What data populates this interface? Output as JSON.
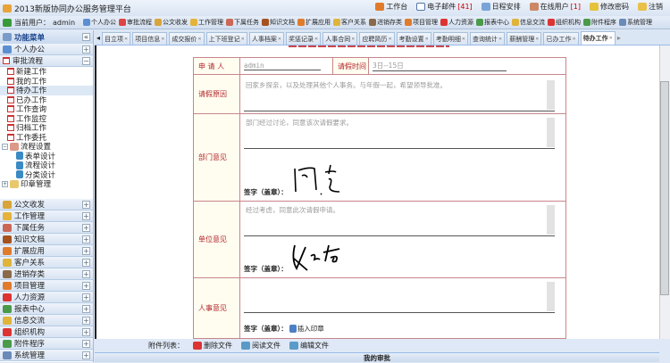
{
  "app": {
    "title": "2013新版协同办公服务管理平台"
  },
  "toplinks": [
    {
      "label": "工作台",
      "icon": "home-icon"
    },
    {
      "label": "电子邮件",
      "count": "[41]",
      "icon": "mail-icon"
    },
    {
      "label": "日程安排",
      "icon": "calendar-icon"
    },
    {
      "label": "在线用户",
      "count": "[1]",
      "icon": "user-icon"
    },
    {
      "label": "修改密码",
      "icon": "key-icon"
    },
    {
      "label": "注销",
      "icon": "logout-icon"
    }
  ],
  "user": {
    "label": "当前用户：",
    "name": "admin"
  },
  "modules": [
    "个人办公",
    "审批流程",
    "公文收发",
    "工作管理",
    "下属任务",
    "知识文档",
    "扩展应用",
    "客户关系",
    "进销存类",
    "项目管理",
    "人力资源",
    "报表中心",
    "信息交流",
    "组织机构",
    "附件程序",
    "系统管理"
  ],
  "sidebar": {
    "title": "功能菜单",
    "open_sections": [
      "个人办公",
      "审批流程"
    ],
    "tree": [
      {
        "label": "新建工作"
      },
      {
        "label": "我的工作"
      },
      {
        "label": "待办工作",
        "selected": true
      },
      {
        "label": "已办工作"
      },
      {
        "label": "工作查询"
      },
      {
        "label": "工作监控"
      },
      {
        "label": "归档工作"
      },
      {
        "label": "工作委托"
      }
    ],
    "flow": {
      "label": "流程设置",
      "children": [
        "表单设计",
        "流程设计",
        "分类设计"
      ]
    },
    "seal": "印章管理",
    "sections": [
      "公文收发",
      "工作管理",
      "下属任务",
      "知识文档",
      "扩展应用",
      "客户关系",
      "进销存类",
      "项目管理",
      "人力资源",
      "报表中心",
      "信息交流",
      "组织机构",
      "附件程序",
      "系统管理"
    ]
  },
  "tabs": [
    "目立项",
    "项目信息",
    "成交报价",
    "上下班登记",
    "人事档案",
    "奖惩记录",
    "人事合同",
    "应聘简历",
    "考勤设置",
    "考勤明细",
    "查询统计",
    "薪酬管理",
    "已办工作",
    "待办工作"
  ],
  "form": {
    "applicant_label": "申 请 人",
    "applicant": "admin",
    "time_label": "请假时间",
    "time": "3日--15日",
    "reason_label": "请假原因",
    "reason": "回家乡探亲，以及处理其他个人事务。与年假一起，希望领导批准。",
    "dept_label": "部门意见",
    "dept": "部门经过讨论，同意该次请假要求。",
    "unit_label": "单位意见",
    "unit": "经过考虑，同意此次请假申请。",
    "hr_label": "人事意见",
    "hr": "",
    "sign_label": "签字（盖章）：",
    "insert_seal": "插入印章"
  },
  "attachments": {
    "label": "附件列表：",
    "delete": "删除文件",
    "read": "阅读文件",
    "edit": "编辑文件"
  },
  "footer": {
    "my_approval": "我的审批"
  },
  "colors": {
    "accent": "#b3262b",
    "border": "#c9858a"
  }
}
